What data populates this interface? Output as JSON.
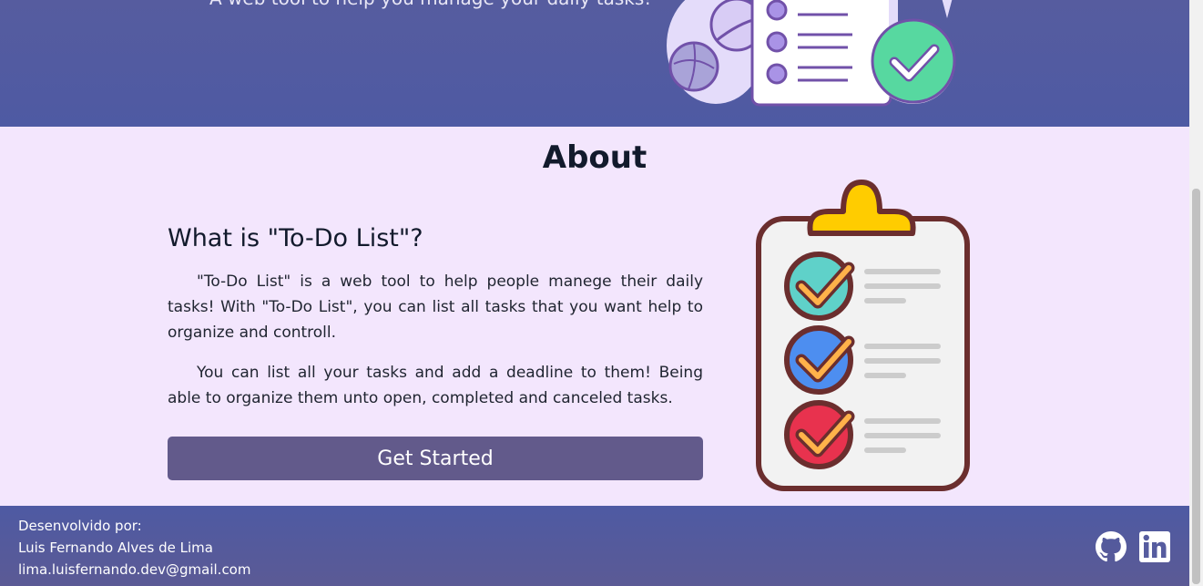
{
  "hero": {
    "tagline": "A web tool to help you manage your daily tasks!",
    "illustration": "todo-checklist-illustration"
  },
  "about": {
    "title": "About",
    "subtitle": "What is \"To-Do List\"?",
    "paragraphs": [
      "\"To-Do List\" is a web tool to help people manege their daily tasks! With \"To-Do List\", you can list all tasks that you want help to organize and controll.",
      "You can list all your tasks and add a deadline to them! Being able to organize them unto open, completed and canceled tasks."
    ],
    "cta_label": "Get Started",
    "illustration": "clipboard-checklist-icon"
  },
  "footer": {
    "credit_label": "Desenvolvido por:",
    "author": "Luis Fernando Alves de Lima",
    "email": "lima.luisfernando.dev@gmail.com",
    "social": [
      {
        "name": "github",
        "icon": "github-icon"
      },
      {
        "name": "linkedin",
        "icon": "linkedin-icon"
      }
    ]
  },
  "colors": {
    "hero_bg": "#4e5aa3",
    "about_bg": "#f3e6fd",
    "button": "#625a8b",
    "footer_bg": "#5b5a95",
    "accent_green": "#57d8a0",
    "clipboard_clip": "#ffcc00"
  }
}
